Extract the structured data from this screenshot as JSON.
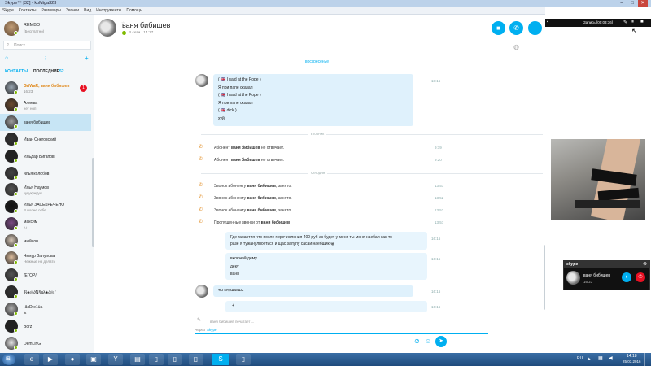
{
  "window": {
    "title": "Skype™ [32] - koMiga323"
  },
  "menu": [
    "Skype",
    "Контакты",
    "Разговоры",
    "Звонки",
    "Вид",
    "Инструменты",
    "Помощь"
  ],
  "profile": {
    "name": "REMBO",
    "status": "(Бесплатно)"
  },
  "search": {
    "placeholder": "Поиск"
  },
  "tabs": {
    "contacts": "КОНТАКТЫ",
    "recent": "ПОСЛЕДНИЕ",
    "recent_count": "52"
  },
  "contacts": [
    {
      "name": "GriWaR, ваня бибишев",
      "sub": "16:23",
      "badge": "1",
      "highlight": true
    },
    {
      "name": "Алиева",
      "sub": "чет ноп"
    },
    {
      "name": "ваня бибишев",
      "sub": "",
      "selected": true
    },
    {
      "name": "Иван Онеговский",
      "sub": ""
    },
    {
      "name": "Ильдар Бигапов",
      "sub": ""
    },
    {
      "name": "илья колобов",
      "sub": ""
    },
    {
      "name": "Илья Наумов",
      "sub": "кукукунуух"
    },
    {
      "name": "Илья ЗАСЕКРЕЧЕНО",
      "sub": "В полне себе..."
    },
    {
      "name": "максим",
      "sub": "♪♪"
    },
    {
      "name": "мыйсон",
      "sub": ""
    },
    {
      "name": "Чимур Залупова",
      "sub": "Нежные не делать"
    },
    {
      "name": "/ЕГОР/",
      "sub": ""
    },
    {
      "name": "ℜ◈◎∂Ñ§µλ◈∂◎ƒ",
      "sub": ""
    },
    {
      "name": "-ãxDre1üa-",
      "sub": "♞"
    },
    {
      "name": "Borz",
      "sub": ""
    },
    {
      "name": "DemLinG",
      "sub": ""
    }
  ],
  "chat": {
    "title": "ваня бибишев",
    "status": "В сети | 14:17",
    "day_top": "воскресенье",
    "msg1": {
      "lines": [
        "( 🇬🇧 I said at the Pope )",
        "Я при папе сказал",
        "( 🇬🇧 I said at the Pope )",
        "Я при папе сказал",
        "( 🇬🇧 dick )",
        "хуй"
      ],
      "time": "18:16"
    },
    "day2": "вторник",
    "calls_tue": [
      {
        "pre": "Абонент ",
        "bold": "ваня бибишев",
        "post": " не отвечает.",
        "time": "9:19"
      },
      {
        "pre": "Абонент ",
        "bold": "ваня бибишев",
        "post": " не отвечает.",
        "time": "9:20"
      }
    ],
    "day3": "Сегодня",
    "calls_today": [
      {
        "pre": "Звонок абоненту ",
        "bold": "ваня бибишев",
        "post": ", занято.",
        "time": "13:51"
      },
      {
        "pre": "Звонок абоненту ",
        "bold": "ваня бибишев",
        "post": ", занято.",
        "time": "13:52"
      },
      {
        "pre": "Звонок абоненту ",
        "bold": "ваня бибишев",
        "post": ", занято.",
        "time": "13:52"
      },
      {
        "pre": "Пропущенные звонки от ",
        "bold": "ваня бибишев",
        "post": "",
        "time": "13:57"
      }
    ],
    "msg2": {
      "lines": [
        "Где гарантия что после перечисления 400 руб ак будет у меня ты меня наебал как-то",
        "разе я тужанулпоеться и щас залупу сасай наебщик 😀"
      ],
      "time": "16:16"
    },
    "msg3": {
      "lines": [
        "включай дему",
        "деку",
        "ваня"
      ],
      "time": "16:15"
    },
    "msg4": {
      "lines": [
        "ты слушаешь"
      ],
      "time": "16:16"
    },
    "msg5": {
      "lines": [
        "+"
      ],
      "time": "16:16"
    },
    "typing": "ваня бибишев печатает ...",
    "via": "через",
    "via_app": "Skype",
    "input_placeholder": ""
  },
  "recorder": {
    "label": "Запись [00:03:36]"
  },
  "mini_call": {
    "app": "skype",
    "name": "ваня бибишев",
    "time": "16:23"
  },
  "clock": {
    "time": "14:18",
    "date": "25.03.2016",
    "lang": "RU"
  },
  "colors": {
    "accent": "#00aff0",
    "status_online": "#7fba00",
    "missed": "#e08a1e",
    "end_call": "#e81123"
  }
}
